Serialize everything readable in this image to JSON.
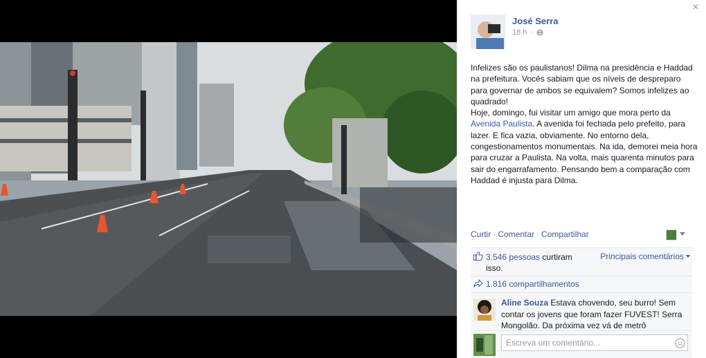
{
  "viewer": {
    "close_icon": "close-icon",
    "close_glyph": "×"
  },
  "post": {
    "author": "José Serra",
    "time": "18 h",
    "privacy_icon": "globe-icon",
    "text_before_link": "Infelizes são os paulistanos! Dilma na presidência e Haddad na prefeitura. Vocês sabiam que os níveis de despreparo para governar de ambos se equivalem? Somos infelizes ao quadrado!\nHoje, domingo, fui visitar um amigo que mora perto da ",
    "link_text": "Avenida Paulista",
    "text_after_link": ". A avenida foi fechada pelo prefeito, para lazer. E fica vazia, obviamente. No entorno dela, congestionamentos monumentais. Na ida, demorei meia hora para cruzar a Paulista. Na volta, mais quarenta minutos para sair do engarrafamento. Pensando bem a comparação com Haddad é injusta para Dilma."
  },
  "actions": {
    "like": "Curtir",
    "comment": "Comentar",
    "share": "Compartilhar",
    "separator": "·"
  },
  "ufi": {
    "like_count": "3.546 pessoas",
    "like_suffix": " curtiram isso.",
    "top_comments": "Principais comentários",
    "shares": "1.816 compartilhamentos",
    "comment": {
      "author": "Aline Souza",
      "text": " Estava chovendo, seu burro! Sem contar os jovens que foram fazer FUVEST! Serra Mongolão. Da próxima vez vá de metrô"
    },
    "composer_placeholder": "Escreva um comentário...",
    "smiley_icon": "smiley-icon"
  },
  "colors": {
    "link": "#3b5998",
    "muted": "#9197a3",
    "ufi_bg": "#f6f7f8"
  }
}
